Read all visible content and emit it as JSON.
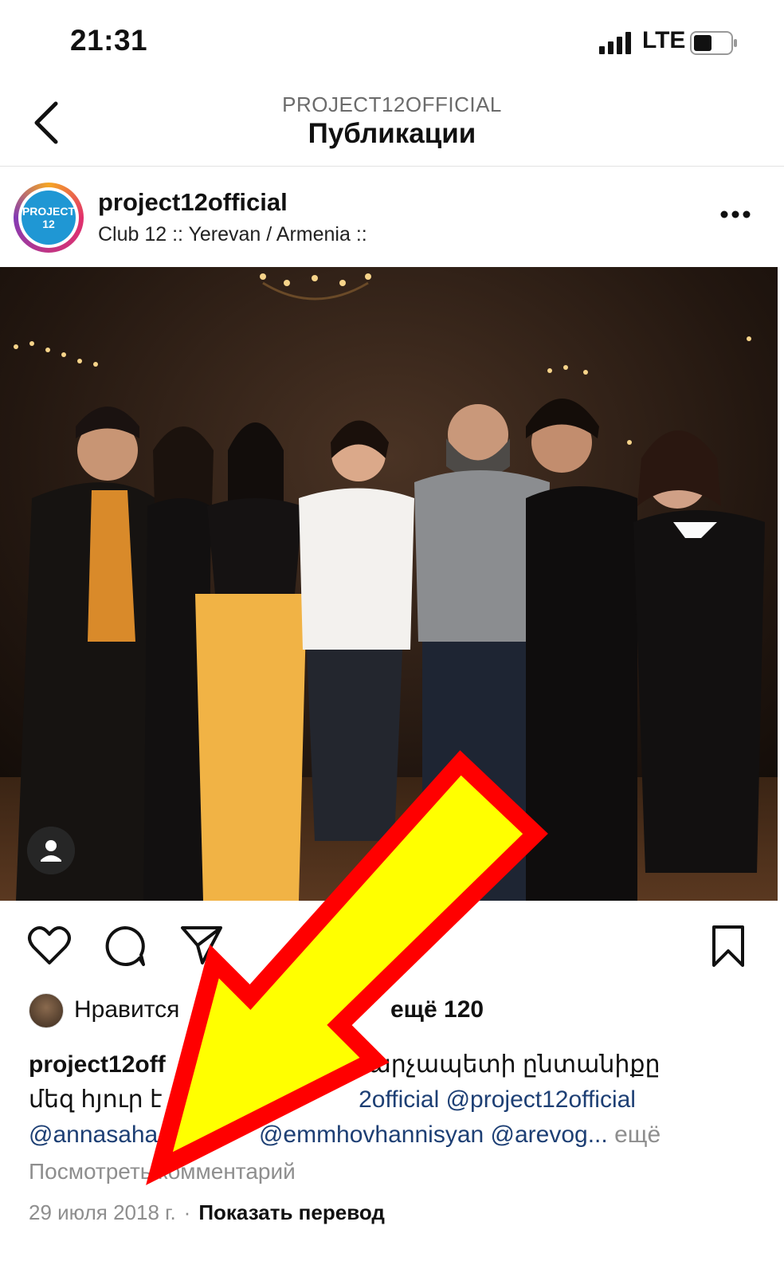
{
  "status_bar": {
    "time": "21:31",
    "network": "LTE"
  },
  "header": {
    "account": "PROJECT12OFFICIAL",
    "title": "Публикации"
  },
  "post": {
    "username": "project12official",
    "location": "Club 12 :: Yerevan / Armenia ::",
    "avatar_text_line1": "PROJECT",
    "avatar_text_line2": "12",
    "likes_prefix": "Нравится",
    "likes_more": "ещё 120",
    "caption": {
      "user": "project12off",
      "line1_visible_tail": "ելի Վարչապետի ընտանիքը",
      "line2_start": "մեզ հյուր է",
      "line2_mentions": "2official @project12official",
      "line3_mention_a": "@annasaha",
      "line3_mentions_b": "@emmhovhannisyan @arevog...",
      "more": "ещё"
    },
    "view_comments": "Посмотреть комментарий",
    "date": "29 июля 2018 г.",
    "separator": "·",
    "translate": "Показать перевод"
  },
  "icons": {
    "back": "chevron-left-icon",
    "more": "more-dots-icon",
    "heart": "heart-icon",
    "comment": "comment-icon",
    "share": "paper-plane-icon",
    "save": "bookmark-icon",
    "tag": "person-tag-icon"
  },
  "colors": {
    "overlay_arrow_fill": "#ffff00",
    "overlay_arrow_stroke": "#ff0000",
    "mention": "#1d3f74",
    "muted": "#8e8e8e"
  }
}
